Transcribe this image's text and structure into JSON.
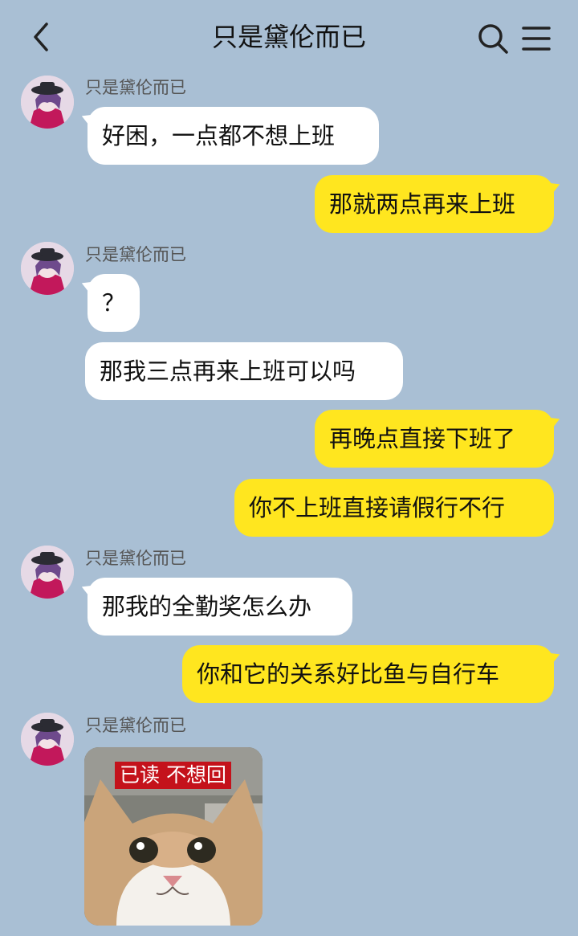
{
  "header": {
    "title": "只是黛伦而已",
    "back_icon": "chevron-left-icon",
    "search_icon": "search-icon",
    "menu_icon": "menu-icon"
  },
  "contact": {
    "name": "只是黛伦而已"
  },
  "messages": [
    {
      "side": "left",
      "text": "好困，一点都不想上班"
    },
    {
      "side": "right",
      "text": "那就两点再来上班"
    },
    {
      "side": "left",
      "text": "？"
    },
    {
      "side": "left",
      "text": "那我三点再来上班可以吗"
    },
    {
      "side": "right",
      "text": "再晚点直接下班了"
    },
    {
      "side": "right",
      "text": "你不上班直接请假行不行"
    },
    {
      "side": "left",
      "text": "那我的全勤奖怎么办"
    },
    {
      "side": "right",
      "text": "你和它的关系好比鱼与自行车"
    }
  ],
  "sticker": {
    "caption": "已读 不想回",
    "subject": "cat-photo"
  },
  "colors": {
    "background": "#a9bfd4",
    "own_bubble": "#ffe61f",
    "other_bubble": "#ffffff",
    "sticker_caption_bg": "#c4121b"
  }
}
